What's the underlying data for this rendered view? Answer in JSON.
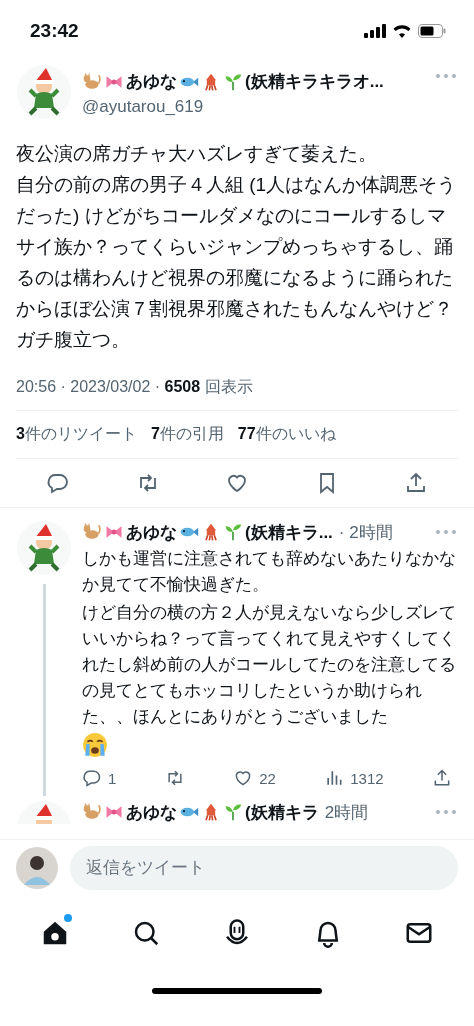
{
  "status_bar": {
    "time": "23:42"
  },
  "tweet": {
    "name_parts": [
      "あゆな",
      "(妖精キラキラオ..."
    ],
    "handle": "@ayutarou_619",
    "text": [
      "夜公演の席ガチャ大ハズレすぎて萎えた。",
      "自分の前の席の男子４人組 (1人はなんか体調悪そうだった) けどがちコールダメなのにコールするしマサイ族か？ってくらいジャンプめっちゃするし、踊るのは構わんけど視界の邪魔になるように踊られたからほぼ公演７割視界邪魔されたもんなんやけど？ガチ腹立つ。"
    ],
    "time": "20:56 · 2023/03/02 · ",
    "views": "6508",
    "views_label": "回表示",
    "stats": [
      {
        "count": "3",
        "label": "件のリツイート"
      },
      {
        "count": "7",
        "label": "件の引用"
      },
      {
        "count": "77",
        "label": "件のいいね"
      }
    ],
    "actions": [
      {
        "kind": "reply"
      },
      {
        "kind": "retweet"
      },
      {
        "kind": "like"
      },
      {
        "kind": "bookmark"
      },
      {
        "kind": "share"
      }
    ]
  },
  "replies": [
    {
      "name_parts": [
        "あゆな",
        "(妖精キラ..."
      ],
      "age": "· 2時間",
      "text": [
        "しかも運営に注意されても辞めないあたりなかなか見てて不愉快過ぎた。",
        "けど自分の横の方２人が見えないなら少しズレていいからね？って言ってくれて見えやすくしてくれたし斜め前の人がコールしてたのを注意してるの見てとてもホッコリしたというか助けられた、、ほんとにありがとうございました"
      ],
      "crying_emoji": true,
      "actions": [
        {
          "kind": "reply",
          "count": "1"
        },
        {
          "kind": "retweet"
        },
        {
          "kind": "like",
          "count": "22"
        },
        {
          "kind": "views",
          "count": "1312"
        },
        {
          "kind": "share"
        }
      ]
    },
    {
      "name_parts": [
        "あゆな",
        "(妖精キラ"
      ],
      "age": "2時間"
    }
  ],
  "reply_bar": {
    "placeholder": "返信をツイート"
  },
  "nav": [
    {
      "kind": "home",
      "selected": true,
      "badge": true
    },
    {
      "kind": "search",
      "selected": false,
      "badge": false
    },
    {
      "kind": "spaces",
      "selected": false,
      "badge": false
    },
    {
      "kind": "notifications",
      "selected": false,
      "badge": false
    },
    {
      "kind": "messages",
      "selected": false,
      "badge": false
    }
  ]
}
